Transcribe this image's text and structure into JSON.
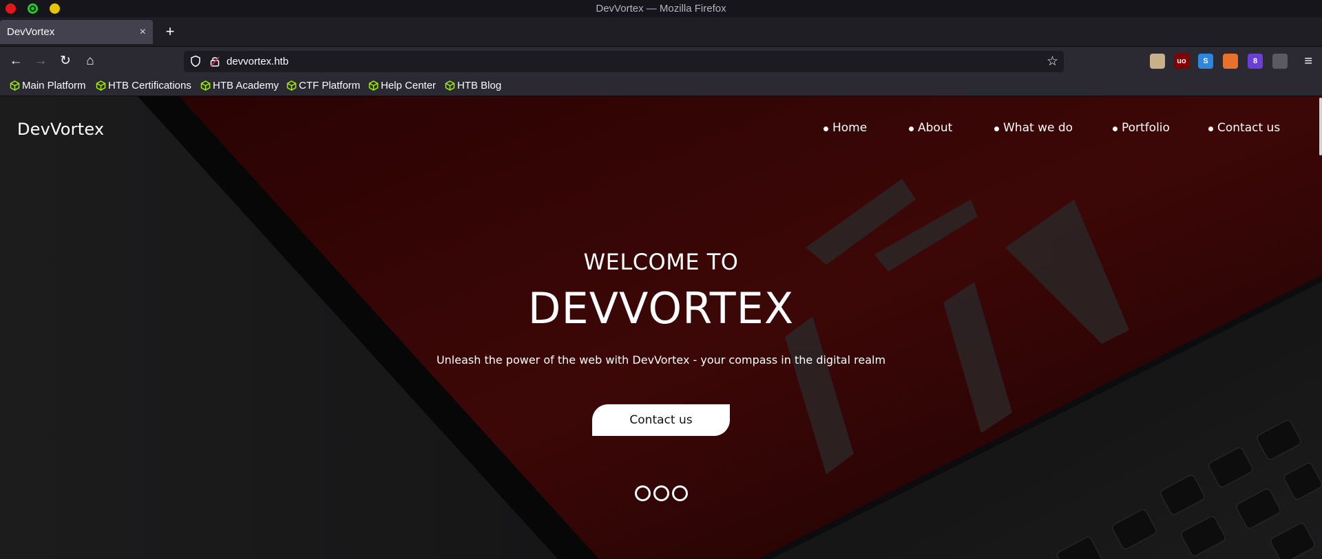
{
  "window": {
    "title": "DevVortex — Mozilla Firefox"
  },
  "tabs": [
    {
      "label": "DevVortex",
      "close": "×"
    }
  ],
  "toolbar": {
    "new_tab": "+",
    "back": "←",
    "forward": "→",
    "reload": "↻",
    "home": "⌂",
    "url": "devvortex.htb",
    "star": "☆",
    "menu": "≡"
  },
  "extensions": [
    {
      "name": "cookie-extension-icon",
      "label": "",
      "color": "#c8b08a"
    },
    {
      "name": "ublock-icon",
      "label": "uo",
      "color": "#800000"
    },
    {
      "name": "s-extension-icon",
      "label": "S",
      "color": "#2e86de"
    },
    {
      "name": "foxy-extension-icon",
      "label": "",
      "color": "#e8722c"
    },
    {
      "name": "purple-extension-icon",
      "label": "8",
      "color": "#6a3fd6"
    },
    {
      "name": "gear-extension-icon",
      "label": "",
      "color": "#5b5a63"
    }
  ],
  "bookmarks": [
    {
      "label": "Main Platform"
    },
    {
      "label": "HTB Certifications"
    },
    {
      "label": "HTB Academy"
    },
    {
      "label": "CTF Platform"
    },
    {
      "label": "Help Center"
    },
    {
      "label": "HTB Blog"
    }
  ],
  "site": {
    "brand": "DevVortex",
    "nav": [
      {
        "label": "Home"
      },
      {
        "label": "About"
      },
      {
        "label": "What we do"
      },
      {
        "label": "Portfolio"
      },
      {
        "label": "Contact us"
      }
    ],
    "hero": {
      "welcome": "WELCOME TO",
      "title": "DEVVORTEX",
      "subtitle": "Unleash the power of the web with DevVortex - your compass in the digital realm",
      "button": "Contact us",
      "slides_count": 3
    }
  },
  "colors": {
    "bookmark_icon": "#9fef00",
    "hero_red": "#3a0606",
    "page_dark": "#0b0a0c"
  }
}
